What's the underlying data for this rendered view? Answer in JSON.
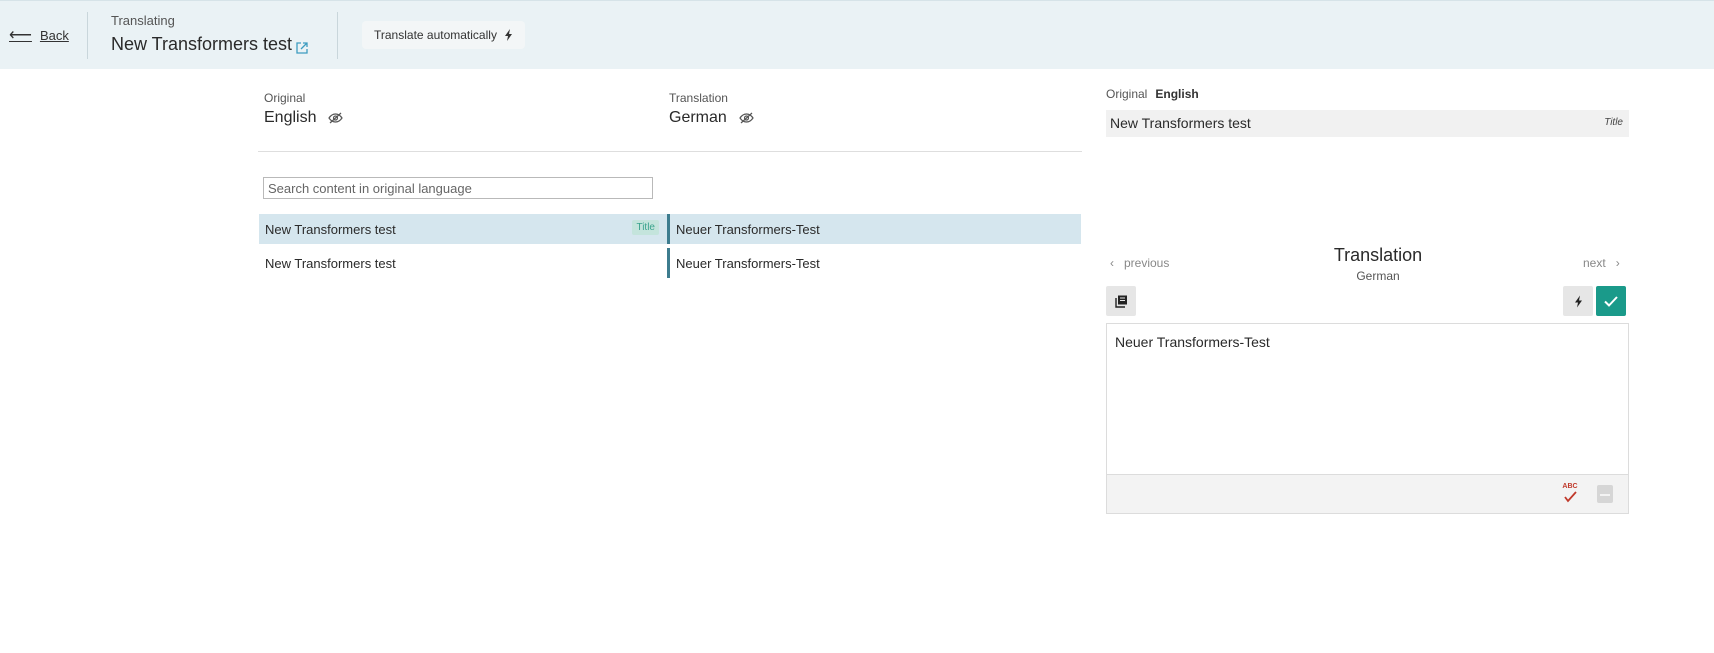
{
  "header": {
    "back_label": "Back",
    "subtitle": "Translating",
    "title": "New Transformers test",
    "auto_translate_label": "Translate automatically"
  },
  "original": {
    "label": "Original",
    "language": "English"
  },
  "translation": {
    "label": "Translation",
    "language": "German"
  },
  "search": {
    "placeholder": "Search content in original language"
  },
  "rows": [
    {
      "original": "New Transformers test",
      "tag": "Title",
      "translation": "Neuer Transformers-Test",
      "selected": true
    },
    {
      "original": "New Transformers test",
      "tag": "",
      "translation": "Neuer Transformers-Test",
      "selected": false
    }
  ],
  "right_panel": {
    "original_label": "Original",
    "original_language": "English",
    "original_text": "New Transformers test",
    "original_tag": "Title",
    "prev_label": "previous",
    "next_label": "next",
    "translation_title": "Translation",
    "translation_language": "German",
    "translation_text": "Neuer Transformers-Test",
    "spellcheck_label": "ABC"
  },
  "colors": {
    "accent": "#1a9a8a",
    "selected_row": "#d5e6ee",
    "header_bg": "#eaf2f5"
  }
}
